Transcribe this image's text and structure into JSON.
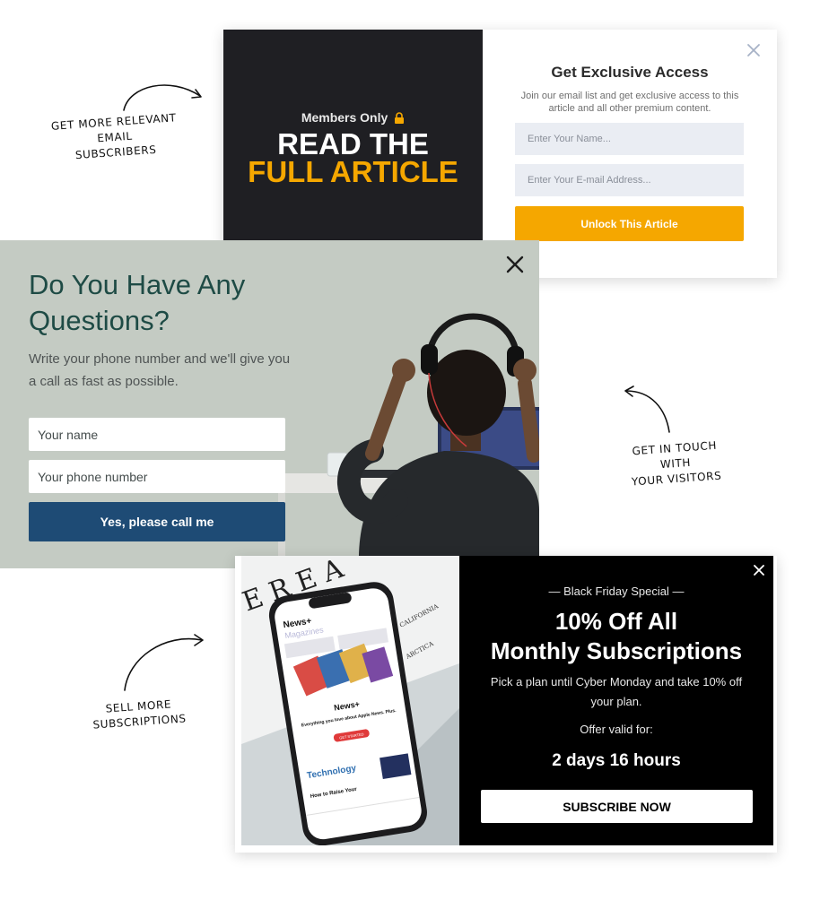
{
  "annotations": {
    "email": [
      "Get more relevant email",
      "subscribers"
    ],
    "touch": [
      "Get in touch with",
      "your visitors"
    ],
    "subscriptions": [
      "Sell more",
      "subscriptions"
    ]
  },
  "popup_exclusive": {
    "members_only": "Members Only",
    "headline_line1": "READ THE",
    "headline_line2": "FULL ARTICLE",
    "title": "Get Exclusive Access",
    "subtitle": "Join our email list and get exclusive access to this article and all other premium content.",
    "name_placeholder": "Enter Your Name...",
    "email_placeholder": "Enter Your E-mail Address...",
    "button_label": "Unlock This Article",
    "accent_color": "#f5a700",
    "close_icon": "close-icon"
  },
  "popup_questions": {
    "title": "Do You Have Any Questions?",
    "subtitle": "Write your phone number and we'll give you a call as fast as possible.",
    "name_placeholder": "Your name",
    "phone_placeholder": "Your phone number",
    "button_label": "Yes, please call me",
    "background_color": "#c4cbc3",
    "button_color": "#1e4b75",
    "close_icon": "close-icon"
  },
  "popup_black_friday": {
    "kicker": "— Black Friday Special —",
    "headline_line1": "10% Off All",
    "headline_line2": "Monthly Subscriptions",
    "description": "Pick a plan until Cyber Monday and take 10% off your plan.",
    "offer_label": "Offer valid for:",
    "countdown": "2 days 16 hours",
    "button_label": "SUBSCRIBE NOW",
    "close_icon": "close-icon",
    "phone_screen": {
      "brand": "News+",
      "section": "Magazines",
      "promo_title": "Everything you love about Apple News. Plus.",
      "promo_button": "GET STARTED",
      "category": "Technology",
      "headline": "How to Raise Your",
      "magazine_letters": "E R E A",
      "map_labels": [
        "CALIFORNIA",
        "ARCTICA"
      ]
    }
  }
}
